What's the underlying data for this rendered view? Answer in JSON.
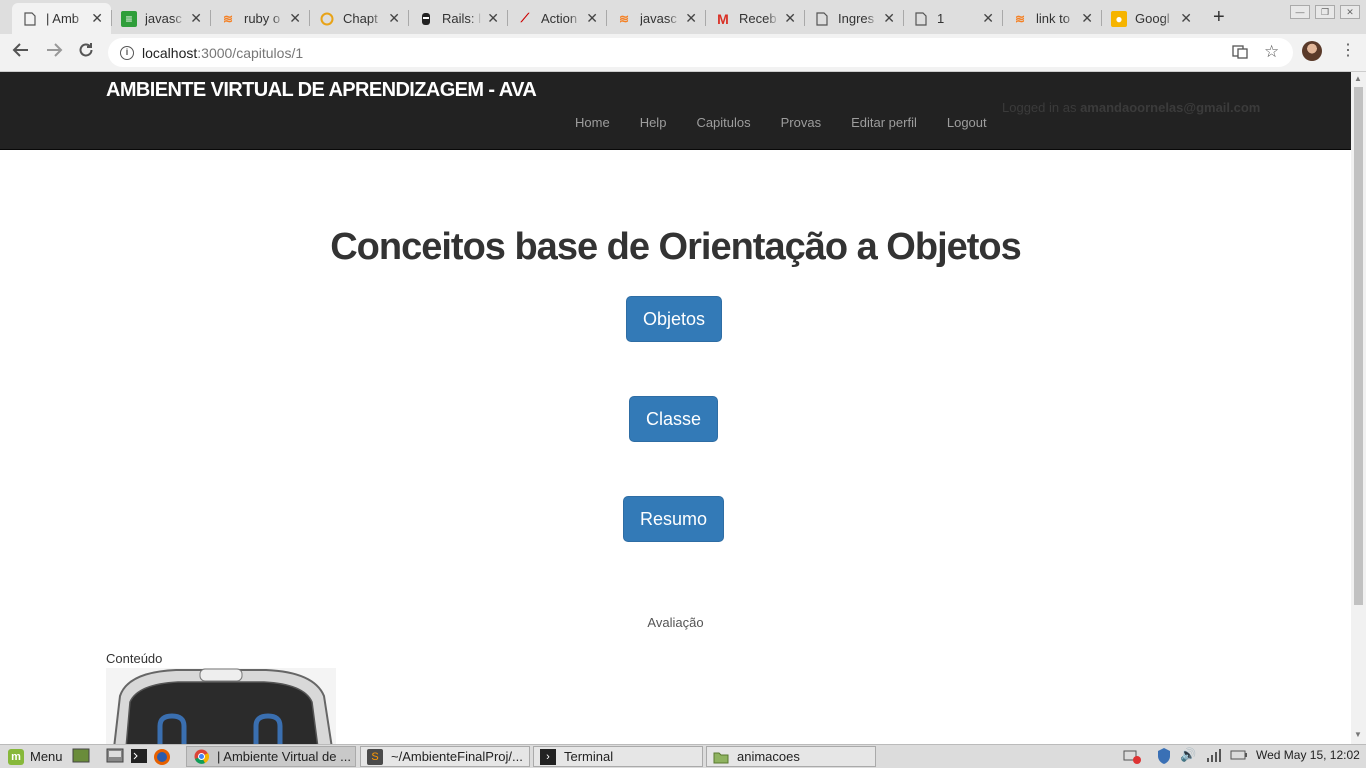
{
  "browser": {
    "tabs": [
      {
        "title": "| Amb",
        "icon": "page-icon"
      },
      {
        "title": "javasc",
        "icon": "stackexchange-icon"
      },
      {
        "title": "ruby o",
        "icon": "stackoverflow-icon"
      },
      {
        "title": "Chapt",
        "icon": "circle-icon"
      },
      {
        "title": "Rails: l",
        "icon": "ninja-icon"
      },
      {
        "title": "Action",
        "icon": "rails-icon"
      },
      {
        "title": "javasc",
        "icon": "stackoverflow-icon"
      },
      {
        "title": "Receb",
        "icon": "gmail-icon"
      },
      {
        "title": "Ingres",
        "icon": "page-icon"
      },
      {
        "title": "1",
        "icon": "page-icon"
      },
      {
        "title": "link to",
        "icon": "stackoverflow-icon"
      },
      {
        "title": "Googl",
        "icon": "keep-icon"
      }
    ],
    "url_host": "localhost",
    "url_path": ":3000/capitulos/1"
  },
  "navbar": {
    "brand": "AMBIENTE VIRTUAL DE APRENDIZAGEM - AVA",
    "logged_prefix": "Logged in as",
    "logged_user": "amandaoornelas@gmail.com",
    "links": [
      "Home",
      "Help",
      "Capitulos",
      "Provas",
      "Editar perfil",
      "Logout"
    ]
  },
  "main": {
    "title": "Conceitos base de Orientação a Objetos",
    "buttons": [
      "Objetos",
      "Classe",
      "Resumo"
    ],
    "evaluation_label": "Avaliação",
    "content_label": "Conteúdo"
  },
  "taskbar": {
    "menu_label": "Menu",
    "windows": [
      "| Ambiente Virtual de ...",
      "~/AmbienteFinalProj/...",
      "Terminal",
      "animacoes"
    ],
    "clock": "Wed May 15, 12:02"
  },
  "colors": {
    "navbar_bg": "#222222",
    "primary_button": "#337ab7",
    "title_text": "#333333"
  }
}
